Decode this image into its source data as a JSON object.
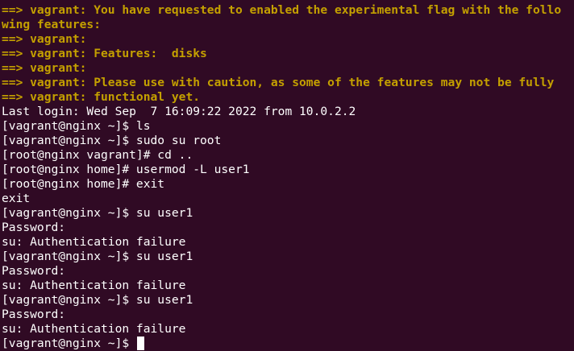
{
  "terminal": {
    "lines": [
      {
        "text": "==> vagrant: You have requested to enabled the experimental flag with the follo",
        "style": "warn"
      },
      {
        "text": "wing features:",
        "style": "warn"
      },
      {
        "text": "==> vagrant:",
        "style": "warn"
      },
      {
        "text": "==> vagrant: Features:  disks",
        "style": "warn"
      },
      {
        "text": "==> vagrant:",
        "style": "warn"
      },
      {
        "text": "==> vagrant: Please use with caution, as some of the features may not be fully",
        "style": "warn"
      },
      {
        "text": "==> vagrant: functional yet.",
        "style": "warn"
      },
      {
        "text": "Last login: Wed Sep  7 16:09:22 2022 from 10.0.2.2",
        "style": "normal"
      },
      {
        "text": "[vagrant@nginx ~]$ ls",
        "style": "normal"
      },
      {
        "text": "[vagrant@nginx ~]$ sudo su root",
        "style": "normal"
      },
      {
        "text": "[root@nginx vagrant]# cd ..",
        "style": "normal"
      },
      {
        "text": "[root@nginx home]# usermod -L user1",
        "style": "normal"
      },
      {
        "text": "[root@nginx home]# exit",
        "style": "normal"
      },
      {
        "text": "exit",
        "style": "normal"
      },
      {
        "text": "[vagrant@nginx ~]$ su user1",
        "style": "normal"
      },
      {
        "text": "Password:",
        "style": "normal"
      },
      {
        "text": "su: Authentication failure",
        "style": "normal"
      },
      {
        "text": "[vagrant@nginx ~]$ su user1",
        "style": "normal"
      },
      {
        "text": "Password:",
        "style": "normal"
      },
      {
        "text": "su: Authentication failure",
        "style": "normal"
      },
      {
        "text": "[vagrant@nginx ~]$ su user1",
        "style": "normal"
      },
      {
        "text": "Password:",
        "style": "normal"
      },
      {
        "text": "su: Authentication failure",
        "style": "normal"
      }
    ],
    "prompt": "[vagrant@nginx ~]$ ",
    "colors": {
      "background": "#300a24",
      "text": "#ffffff",
      "warning": "#c4a000"
    }
  }
}
